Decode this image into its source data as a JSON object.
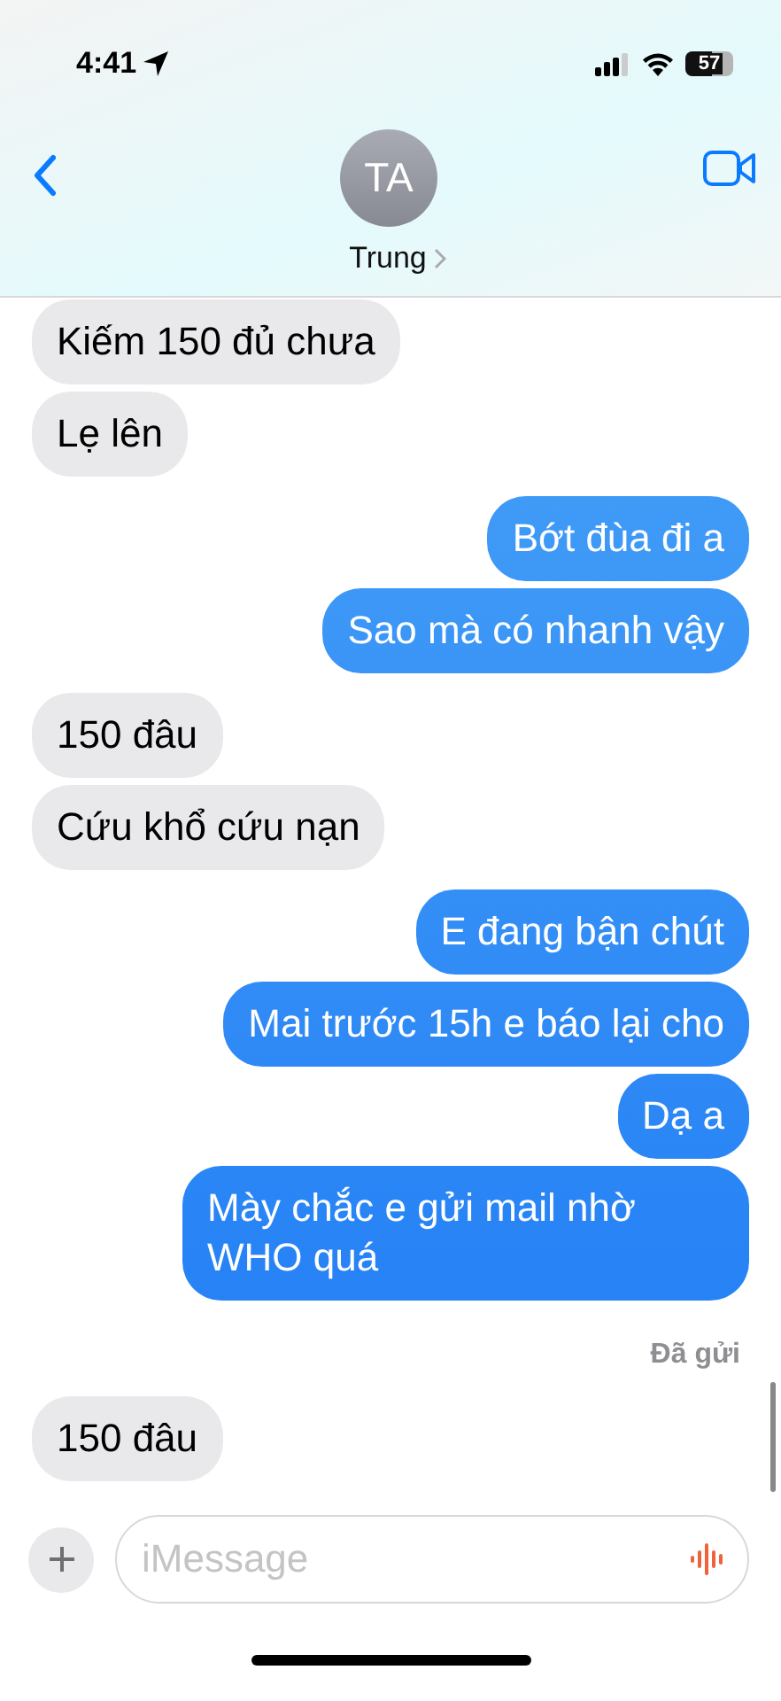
{
  "status_bar": {
    "time": "4:41",
    "battery": "57"
  },
  "header": {
    "avatar_initials": "TA",
    "contact_name": "Trung"
  },
  "messages": [
    {
      "kind": "received",
      "text": "Kiếm 150 đủ chưa"
    },
    {
      "kind": "received",
      "text": "Lẹ lên"
    },
    {
      "kind": "sent",
      "text": "Bớt đùa đi a"
    },
    {
      "kind": "sent",
      "text": "Sao mà có nhanh vậy"
    },
    {
      "kind": "received",
      "text": "150 đâu"
    },
    {
      "kind": "received",
      "text": "Cứu khổ cứu nạn"
    },
    {
      "kind": "sent",
      "text": "E đang bận chút"
    },
    {
      "kind": "sent",
      "text": "Mai trước 15h e báo lại cho"
    },
    {
      "kind": "sent",
      "text": "Dạ a"
    },
    {
      "kind": "sent",
      "text": "Mày chắc e gửi mail nhờ WHO quá"
    },
    {
      "kind": "status",
      "text": "Đã gửi"
    },
    {
      "kind": "received",
      "text": "150 đâu"
    }
  ],
  "composer": {
    "placeholder": "iMessage"
  }
}
